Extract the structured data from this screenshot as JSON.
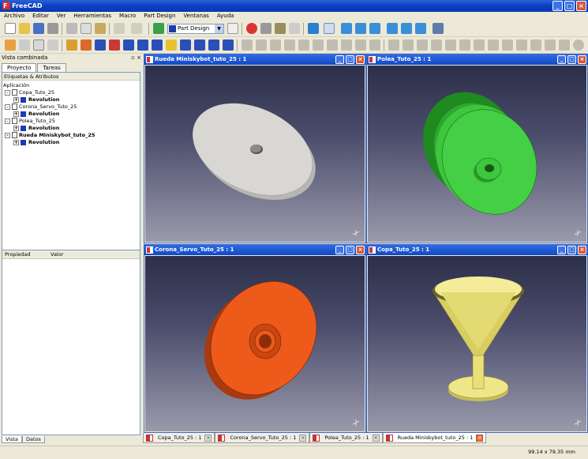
{
  "app": {
    "title": "FreeCAD"
  },
  "menu": [
    "Archivo",
    "Editar",
    "Ver",
    "Herramientas",
    "Macro",
    "Part Design",
    "Ventanas",
    "Ayuda"
  ],
  "workbench": {
    "selected": "Part Design"
  },
  "left_panel": {
    "title": "Vista combinada",
    "tabs": [
      "Proyecto",
      "Tareas"
    ],
    "tree_header": "Etiquetas & Atributos",
    "tree_root": "Aplicación",
    "tree": [
      {
        "doc": "Copa_Tuto_25",
        "child": "Revolution",
        "bold": false
      },
      {
        "doc": "Corona_Servo_Tuto_25",
        "child": "Revolution",
        "bold": false
      },
      {
        "doc": "Polea_Tuto_25",
        "child": "Revolution",
        "bold": false
      },
      {
        "doc": "Rueda Miniskybot_tuto_25",
        "child": "Revolution",
        "bold": true
      }
    ],
    "property_cols": [
      "Propiedad",
      "Valor"
    ],
    "bottom_tabs": [
      "Vista",
      "Datos"
    ]
  },
  "views": [
    {
      "title": "Rueda Miniskybot_tuto_25 : 1",
      "model": "disc",
      "color": "#d8d6d2"
    },
    {
      "title": "Polea_Tuto_25 : 1",
      "model": "pulley",
      "color": "#3ec63e"
    },
    {
      "title": "Corona_Servo_Tuto_25 : 1",
      "model": "gear",
      "color": "#ee5a1a"
    },
    {
      "title": "Copa_Tuto_25 : 1",
      "model": "cup",
      "color": "#e9e07a"
    }
  ],
  "doc_tabs": [
    {
      "label": "Copa_Tuto_25 : 1",
      "active": false
    },
    {
      "label": "Corona_Servo_Tuto_25 : 1",
      "active": false
    },
    {
      "label": "Polea_Tuto_25 : 1",
      "active": false
    },
    {
      "label": "Rueda Miniskybot_tuto_25 : 1",
      "active": true
    }
  ],
  "status": {
    "dimensions": "99.14 x 79.35 mm"
  }
}
